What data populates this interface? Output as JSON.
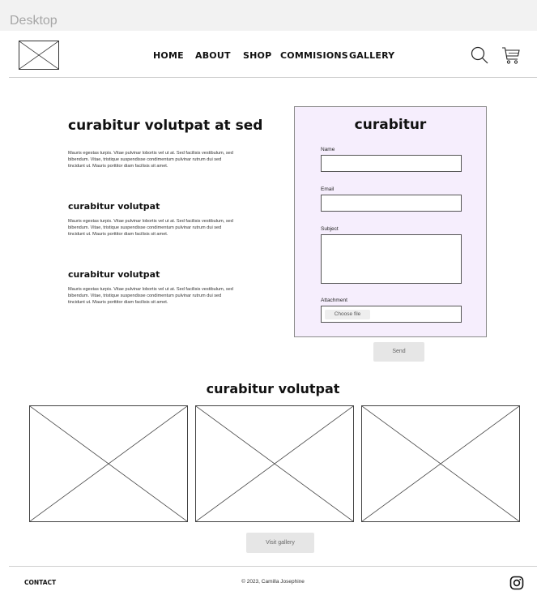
{
  "frame": {
    "label": "Desktop"
  },
  "header": {
    "nav": [
      {
        "label": "HOME"
      },
      {
        "label": "ABOUT"
      },
      {
        "label": "SHOP"
      },
      {
        "label": "COMMISIONS"
      },
      {
        "label": "GALLERY"
      }
    ],
    "icons": [
      "search-icon",
      "cart-icon"
    ]
  },
  "intro": {
    "title": "curabitur volutpat at sed",
    "sections": [
      {
        "heading": "",
        "text": "Mauris egestas turpis. Vitae pulvinar lobortis vel ut at. Sed facilisis vestibulum, sed bibendum. Vitae, tristique suspendisse condimentum pulvinar rutrum dui sed tincidunt ut. Mauris porttitor diam facilisis sit amet."
      },
      {
        "heading": "curabitur volutpat",
        "text": "Mauris egestas turpis. Vitae pulvinar lobortis vel ut at. Sed facilisis vestibulum, sed bibendum. Vitae, tristique suspendisse condimentum pulvinar rutrum dui sed tincidunt ut. Mauris porttitor diam facilisis sit amet."
      },
      {
        "heading": "curabitur volutpat",
        "text": "Mauris egestas turpis. Vitae pulvinar lobortis vel ut at. Sed facilisis vestibulum, sed bibendum. Vitae, tristique suspendisse condimentum pulvinar rutrum dui sed tincidunt ut. Mauris porttitor diam facilisis sit amet."
      }
    ]
  },
  "form": {
    "title": "curabitur",
    "name_label": "Name",
    "name_value": "",
    "email_label": "Email",
    "email_value": "",
    "subject_label": "Subject",
    "subject_value": "",
    "attachment_label": "Attachment",
    "choose_file_label": "Choose file",
    "send_label": "Send"
  },
  "gallery": {
    "title": "curabitur volutpat",
    "image_count_visible": 3,
    "visit_label": "Visit gallery"
  },
  "footer": {
    "contact_label": "CONTACT",
    "copyright": "© 2023, Camilla Josephine",
    "icons": [
      "instagram-icon"
    ]
  },
  "colors": {
    "form_background": "#f6eefd",
    "button_background": "#e6e6e6",
    "frame_label": "#a7a7a7"
  }
}
